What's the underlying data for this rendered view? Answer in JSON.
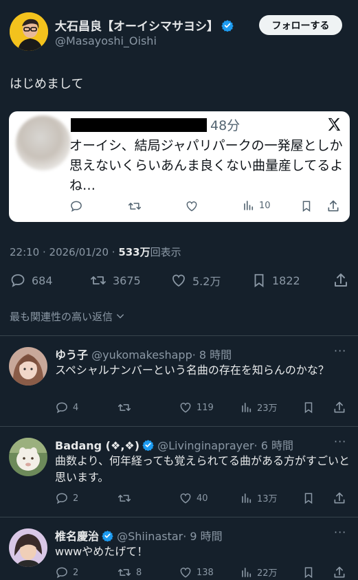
{
  "tweet": {
    "author_name": "大石昌良【オーイシマサヨシ】",
    "author_handle": "@Masayoshi_Oishi",
    "follow_label": "フォローする",
    "text": "はじめまして",
    "timestamp": "22:10 · 2026/01/20 ·",
    "views_count": "533万",
    "views_label": "回表示",
    "replies": "684",
    "retweets": "3675",
    "likes": "5.2万",
    "bookmarks": "1822"
  },
  "embed": {
    "time": "48分",
    "text": "オーイシ、結局ジャパリパークの一発屋としか思えないくらいあんま良くない曲量産してるよね…",
    "views": "10"
  },
  "sort_label": "最も関連性の高い返信",
  "replies": [
    {
      "name": "ゆう子",
      "handle": "@yukomakeshapp",
      "time": "· 8 時間",
      "text": "スペシャルナンバーという名曲の存在を知らんのかな？",
      "replies": "4",
      "retweets": "",
      "likes": "119",
      "views": "23万",
      "more": "···"
    },
    {
      "name": "Badang (❖,❖)",
      "handle": "@Livinginaprayer",
      "time": "· 6 時間",
      "text": "曲数より、何年経っても覚えられてる曲がある方がすごいと思います。",
      "replies": "2",
      "retweets": "",
      "likes": "40",
      "views": "13万",
      "more": "···"
    },
    {
      "name": "椎名慶治",
      "handle": "@Shiinastar",
      "time": "· 9 時間",
      "text": "wwwやめたげて！",
      "replies": "2",
      "retweets": "8",
      "likes": "138",
      "views": "22万",
      "more": "···"
    }
  ],
  "colors": {
    "background": "#15202b",
    "verified": "#1d9bf0",
    "muted": "#8b98a5",
    "card": "#ffffff"
  }
}
